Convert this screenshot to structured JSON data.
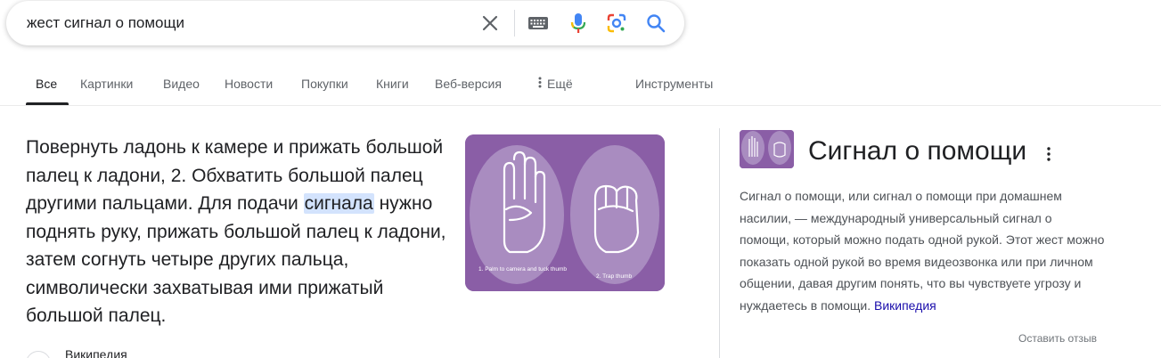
{
  "search": {
    "query": "жест сигнал о помощи",
    "icons": [
      "close-icon",
      "keyboard-icon",
      "microphone-icon",
      "google-lens-icon",
      "search-icon"
    ]
  },
  "tabs": {
    "items": [
      {
        "label": "Все",
        "active": true
      },
      {
        "label": "Картинки"
      },
      {
        "label": "Видео"
      },
      {
        "label": "Новости"
      },
      {
        "label": "Покупки"
      },
      {
        "label": "Книги"
      },
      {
        "label": "Веб-версия"
      }
    ],
    "more_label": "Ещё",
    "tools_label": "Инструменты"
  },
  "snippet": {
    "text_before": "Повернуть ладонь к камере и прижать большой палец к ладони, 2. Обхватить большой палец другими пальцами. Для подачи ",
    "text_highlight": "сигнала",
    "text_after": " нужно поднять руку, прижать большой палец к ладони, затем согнуть четыре других пальца, символически захватывая ими прижатый большой палец.",
    "image": {
      "caption_1": "1. Palm to camera and tuck thumb",
      "caption_2": "2. Trap thumb"
    },
    "source_name": "Википедия"
  },
  "knowledge_panel": {
    "title": "Сигнал о помощи",
    "description": "Сигнал о помощи, или сигнал о помощи при домашнем насилии, — международный универсальный сигнал о помощи, который можно подать одной рукой. Этот жест можно показать одной рукой во время видеозвонка или при личном общении, давая другим понять, что вы чувствуете угрозу и нуждаетесь в помощи.",
    "source_link": "Википедия",
    "feedback": "Оставить отзыв"
  },
  "colors": {
    "link": "#1a0dab",
    "highlight": "#d3e3fd",
    "image_bg": "#8a5ea6",
    "search_icon": "#4285f4"
  }
}
